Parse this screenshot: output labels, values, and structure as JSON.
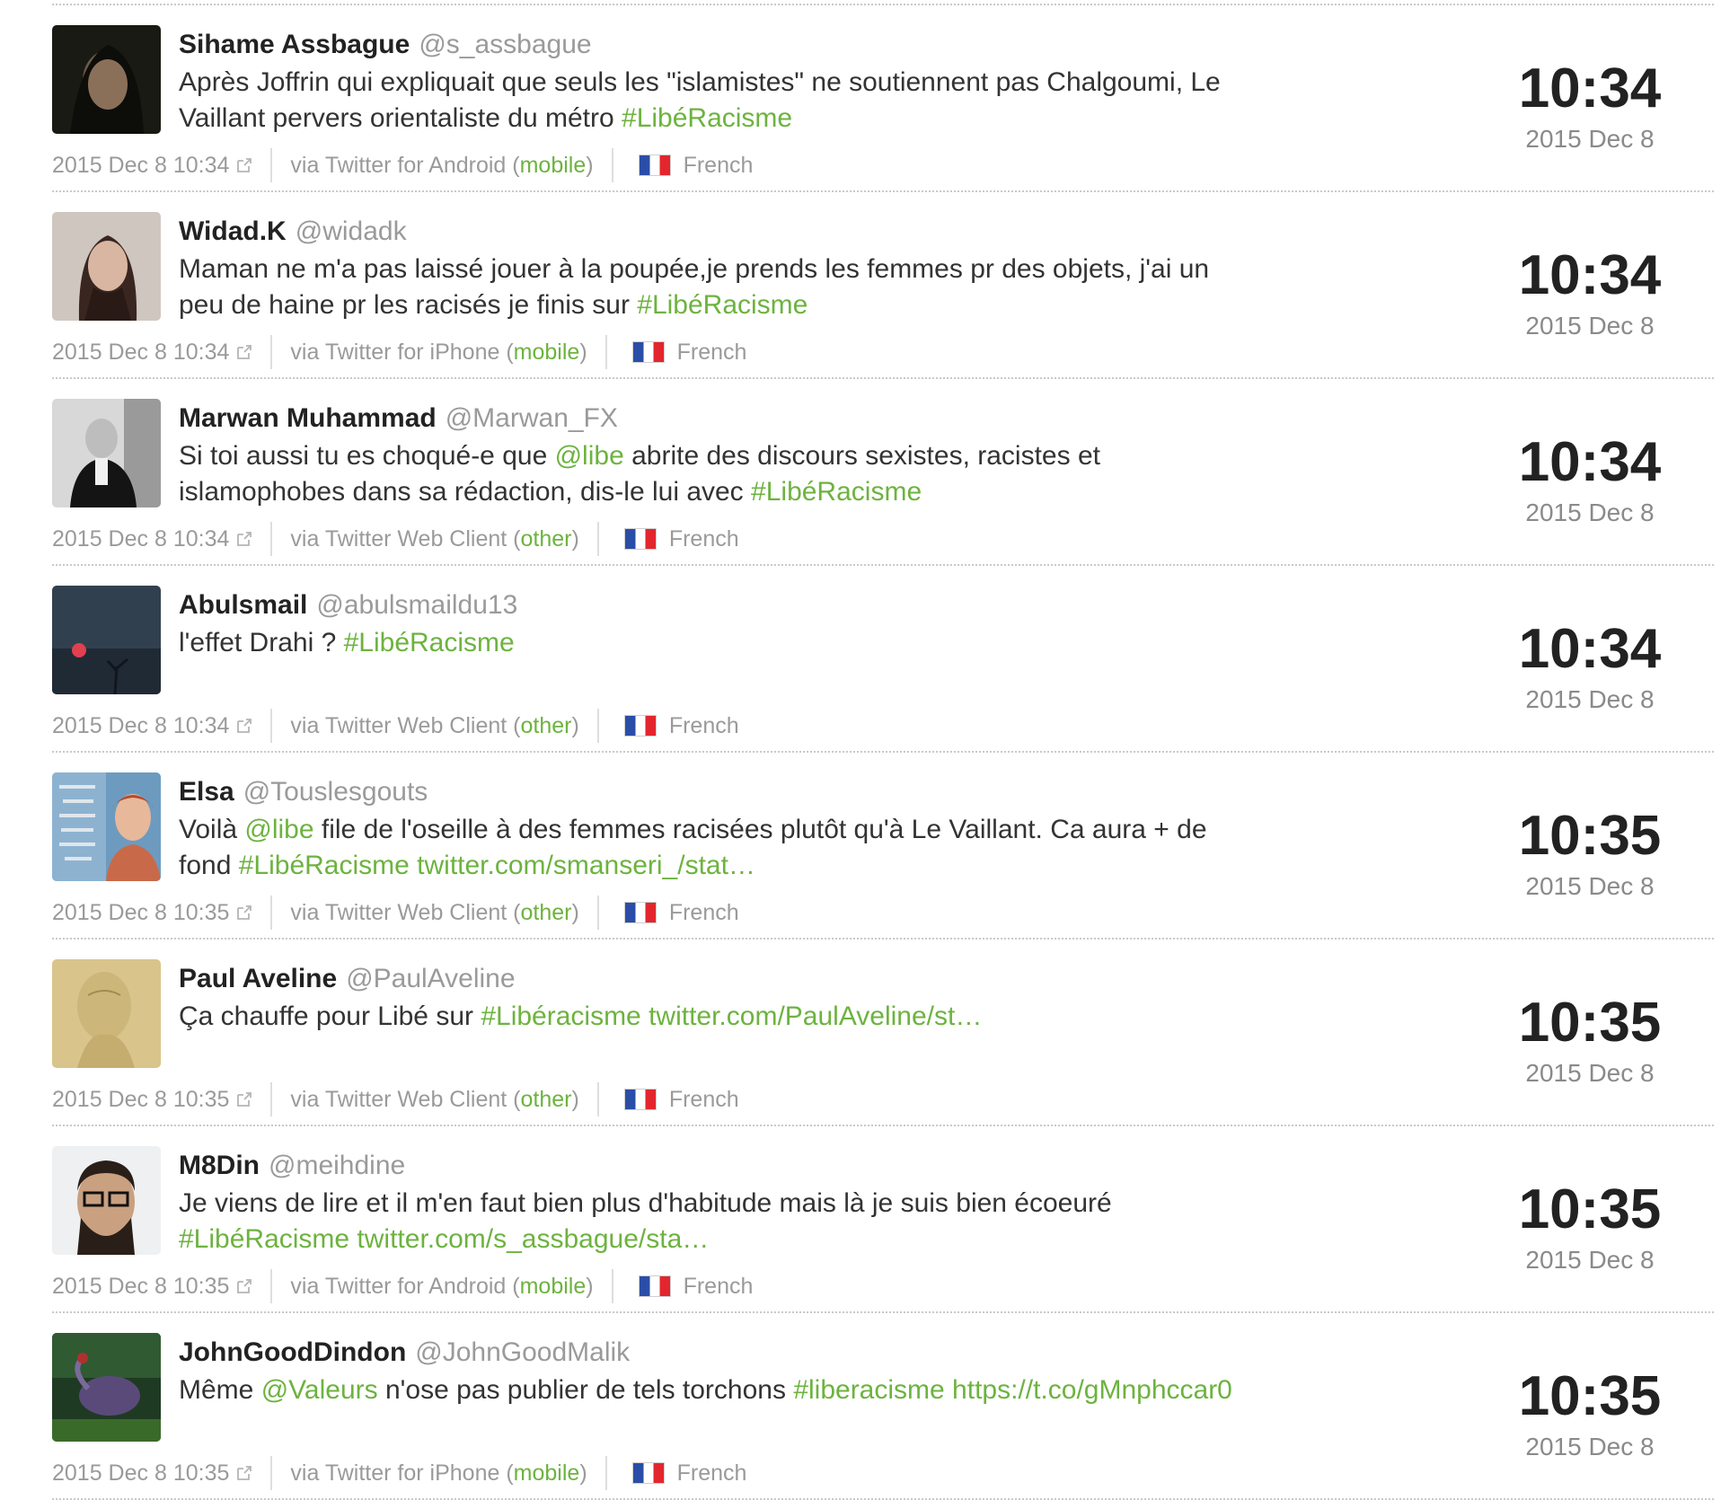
{
  "tweets": [
    {
      "name": "Sihame Assbague",
      "handle": "@s_assbague",
      "text_parts": [
        {
          "t": "Après Joffrin qui expliquait que seuls les \"islamistes\" ne soutiennent pas Chalgoumi, Le Vaillant pervers orientaliste du métro ",
          "hl": false
        },
        {
          "t": "#LibéRacisme",
          "hl": true
        }
      ],
      "timestamp": "2015 Dec 8 10:34",
      "via": "via Twitter for Android (",
      "source_type": "mobile",
      "via_close": ")",
      "language": "French",
      "clock": "10:34",
      "date": "2015 Dec 8",
      "avatar": "avatar-dark-portrait"
    },
    {
      "name": "Widad.K",
      "handle": "@widadk",
      "text_parts": [
        {
          "t": "Maman ne m'a pas laissé jouer à la poupée,je prends les femmes pr des objets, j'ai un peu de haine pr les racisés je finis sur ",
          "hl": false
        },
        {
          "t": "#LibéRacisme",
          "hl": true
        }
      ],
      "timestamp": "2015 Dec 8 10:34",
      "via": "via Twitter for iPhone (",
      "source_type": "mobile",
      "via_close": ")",
      "language": "French",
      "clock": "10:34",
      "date": "2015 Dec 8",
      "avatar": "avatar-woman-portrait"
    },
    {
      "name": "Marwan Muhammad",
      "handle": "@Marwan_FX",
      "text_parts": [
        {
          "t": "Si toi aussi tu es choqué-e que ",
          "hl": false
        },
        {
          "t": "@libe",
          "hl": true
        },
        {
          "t": " abrite des discours sexistes, racistes et islamophobes dans sa rédaction, dis-le lui avec ",
          "hl": false
        },
        {
          "t": "#LibéRacisme",
          "hl": true
        }
      ],
      "timestamp": "2015 Dec 8 10:34",
      "via": "via Twitter Web Client (",
      "source_type": "other",
      "via_close": ")",
      "language": "French",
      "clock": "10:34",
      "date": "2015 Dec 8",
      "avatar": "avatar-bw-portrait"
    },
    {
      "name": "Abulsmail",
      "handle": "@abulsmaildu13",
      "text_parts": [
        {
          "t": "l'effet Drahi ? ",
          "hl": false
        },
        {
          "t": "#LibéRacisme",
          "hl": true
        }
      ],
      "timestamp": "2015 Dec 8 10:34",
      "via": "via Twitter Web Client (",
      "source_type": "other",
      "via_close": ")",
      "language": "French",
      "clock": "10:34",
      "date": "2015 Dec 8",
      "avatar": "avatar-dusk-sky"
    },
    {
      "name": "Elsa",
      "handle": "@Touslesgouts",
      "text_parts": [
        {
          "t": "Voilà ",
          "hl": false
        },
        {
          "t": "@libe",
          "hl": true
        },
        {
          "t": " file de l'oseille à des femmes racisées plutôt qu'à Le Vaillant. Ca aura + de fond ",
          "hl": false
        },
        {
          "t": "#LibéRacisme twitter.com/smanseri_/stat…",
          "hl": true
        }
      ],
      "timestamp": "2015 Dec 8 10:35",
      "via": "via Twitter Web Client (",
      "source_type": "other",
      "via_close": ")",
      "language": "French",
      "clock": "10:35",
      "date": "2015 Dec 8",
      "avatar": "avatar-book-cover"
    },
    {
      "name": "Paul Aveline",
      "handle": "@PaulAveline",
      "text_parts": [
        {
          "t": "Ça chauffe pour Libé sur ",
          "hl": false
        },
        {
          "t": "#Libéracisme twitter.com/PaulAveline/st…",
          "hl": true
        }
      ],
      "timestamp": "2015 Dec 8 10:35",
      "via": "via Twitter Web Client (",
      "source_type": "other",
      "via_close": ")",
      "language": "French",
      "clock": "10:35",
      "date": "2015 Dec 8",
      "avatar": "avatar-sepia-sketch"
    },
    {
      "name": "M8Din",
      "handle": "@meihdine",
      "text_parts": [
        {
          "t": "Je viens de lire et il m'en faut bien plus d'habitude mais là je suis bien écoeuré ",
          "hl": false
        },
        {
          "t": "#LibéRacisme twitter.com/s_assbague/sta…",
          "hl": true
        }
      ],
      "timestamp": "2015 Dec 8 10:35",
      "via": "via Twitter for Android (",
      "source_type": "mobile",
      "via_close": ")",
      "language": "French",
      "clock": "10:35",
      "date": "2015 Dec 8",
      "avatar": "avatar-man-glasses"
    },
    {
      "name": "JohnGoodDindon",
      "handle": "@JohnGoodMalik",
      "text_parts": [
        {
          "t": "Même ",
          "hl": false
        },
        {
          "t": "@Valeurs",
          "hl": true
        },
        {
          "t": " n'ose pas publier de tels torchons ",
          "hl": false
        },
        {
          "t": "#liberacisme https://t.co/gMnphccar0",
          "hl": true
        }
      ],
      "timestamp": "2015 Dec 8 10:35",
      "via": "via Twitter for iPhone (",
      "source_type": "mobile",
      "via_close": ")",
      "language": "French",
      "clock": "10:35",
      "date": "2015 Dec 8",
      "avatar": "avatar-turkey-bird"
    }
  ],
  "colors": {
    "highlight": "#6db33f",
    "muted": "#9a9a9a",
    "flag": [
      "#2a4ea8",
      "#ffffff",
      "#e3262d"
    ]
  }
}
